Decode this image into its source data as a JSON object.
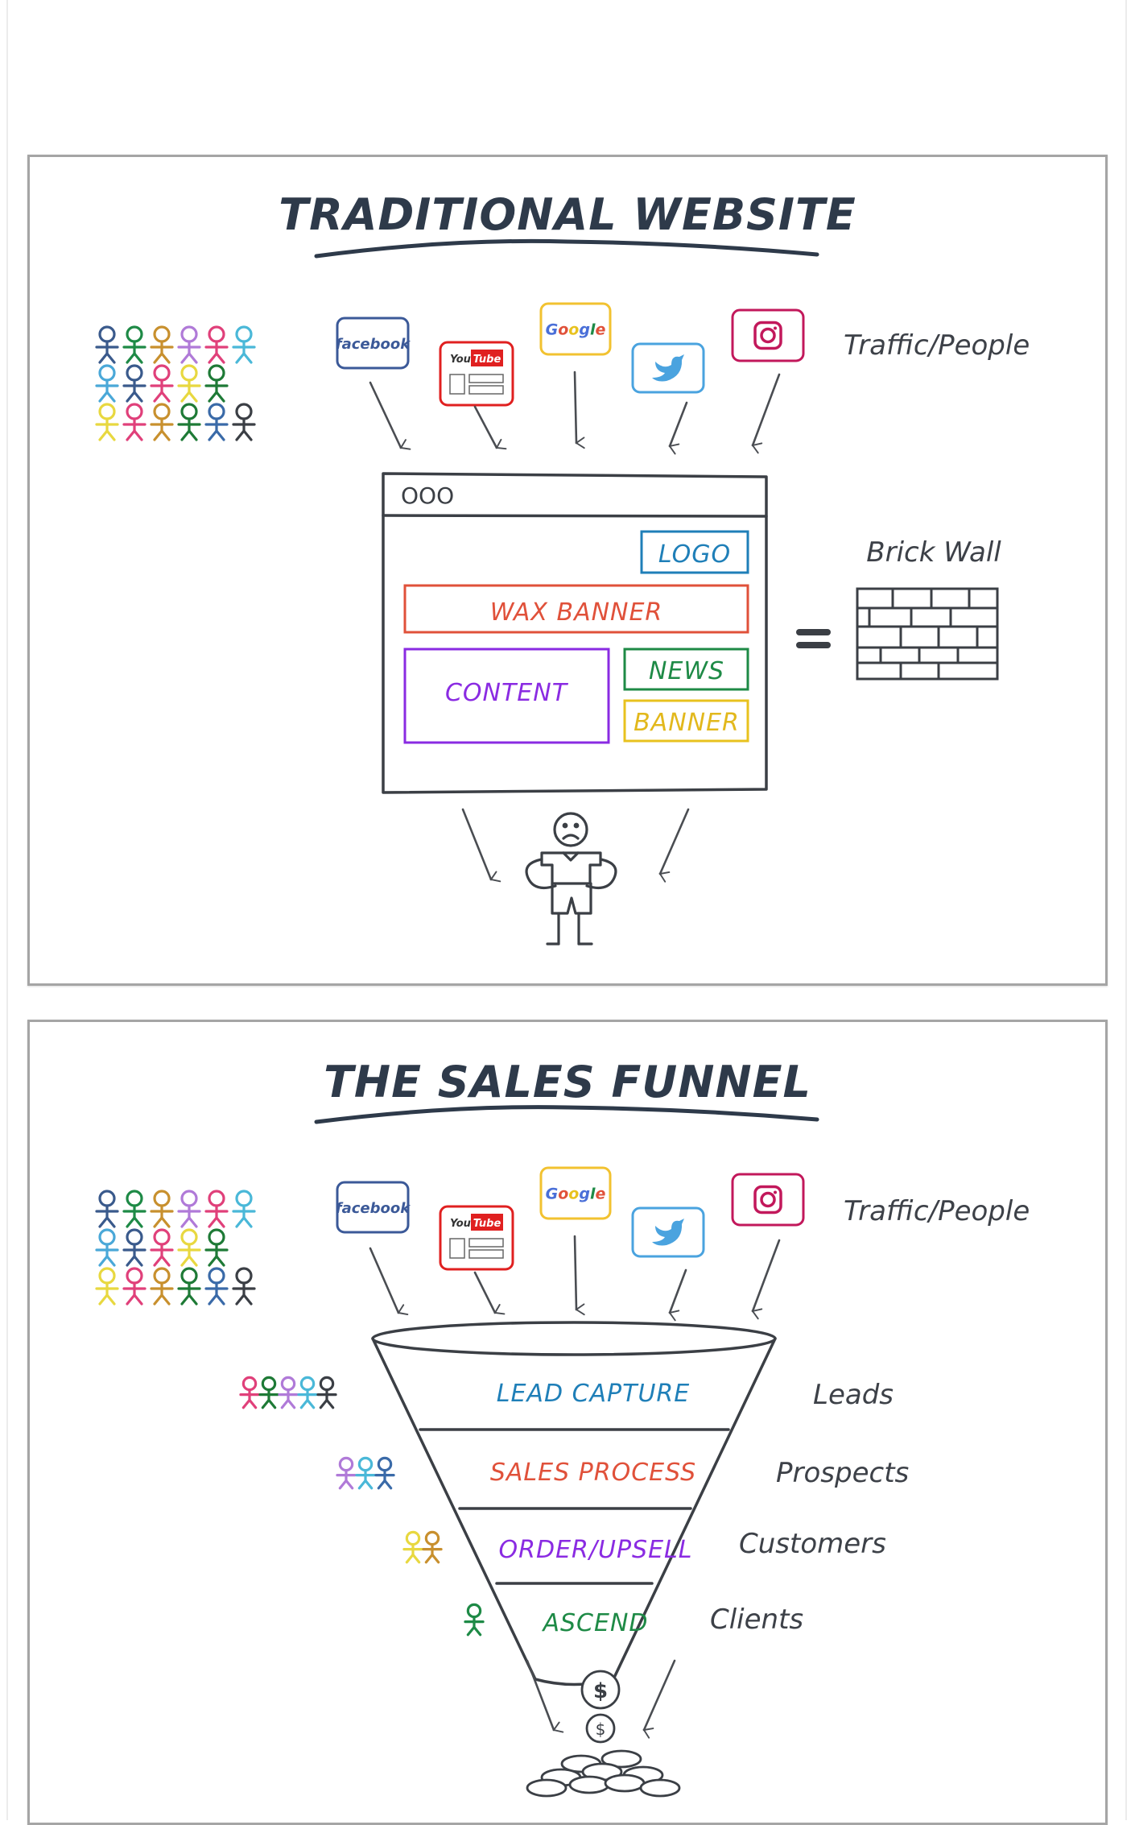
{
  "sections": {
    "traditional": {
      "title": "TRADITIONAL WEBSITE",
      "traffic_label": "Traffic/People",
      "brick_wall_label": "Brick Wall",
      "equals": "=",
      "browser": {
        "window_dots": "OOO",
        "boxes": [
          {
            "label": "LOGO",
            "color": "#1f7fb8"
          },
          {
            "label": "WAX BANNER",
            "color": "#e0513a"
          },
          {
            "label": "CONTENT",
            "color": "#8a2be2"
          },
          {
            "label": "NEWS",
            "color": "#1e8a46"
          },
          {
            "label": "BANNER",
            "color": "#e8c21e"
          }
        ]
      },
      "sad_person": "sad-person"
    },
    "funnel": {
      "title": "THE SALES FUNNEL",
      "traffic_label": "Traffic/People",
      "stages": [
        {
          "label": "LEAD CAPTURE",
          "color": "#1f7fb8",
          "outcome": "Leads",
          "people_count": 5
        },
        {
          "label": "SALES PROCESS",
          "color": "#e0513a",
          "outcome": "Prospects",
          "people_count": 3
        },
        {
          "label": "ORDER/UPSELL",
          "color": "#8a2be2",
          "outcome": "Customers",
          "people_count": 2
        },
        {
          "label": "ASCEND",
          "color": "#1e8a46",
          "outcome": "Clients",
          "people_count": 1
        }
      ],
      "coin_symbol": "$"
    }
  },
  "traffic_sources": [
    {
      "name": "facebook",
      "label": "facebook",
      "color": "#3b5998"
    },
    {
      "name": "youtube",
      "label_you": "You",
      "label_tube": "Tube",
      "color": "#e02020"
    },
    {
      "name": "google",
      "label": "Google",
      "color": "#f2c230"
    },
    {
      "name": "twitter",
      "label": "twitter",
      "color": "#4aa3df"
    },
    {
      "name": "instagram",
      "label": "instagram",
      "color": "#c2185b"
    }
  ],
  "crowd": {
    "rows": [
      [
        "#3a5a8c",
        "#1e8a46",
        "#c8902e",
        "#b07ad8",
        "#e0407a",
        "#4ab8d8"
      ],
      [
        "#4aa8d8",
        "#3a5a8c",
        "#e0407a",
        "#e8d840",
        "#1e7a36"
      ],
      [
        "#e8d840",
        "#e0407a",
        "#c8902e",
        "#1e7a36",
        "#3a6aa8",
        "#3b3f45"
      ]
    ]
  },
  "funnel_people": [
    [
      "#e0407a",
      "#1e7a36",
      "#b07ad8",
      "#4ab8d8",
      "#3b3f45"
    ],
    [
      "#b07ad8",
      "#4ab8d8",
      "#3a6aa8"
    ],
    [
      "#e8d840",
      "#c8902e"
    ],
    [
      "#1e8a46"
    ]
  ]
}
